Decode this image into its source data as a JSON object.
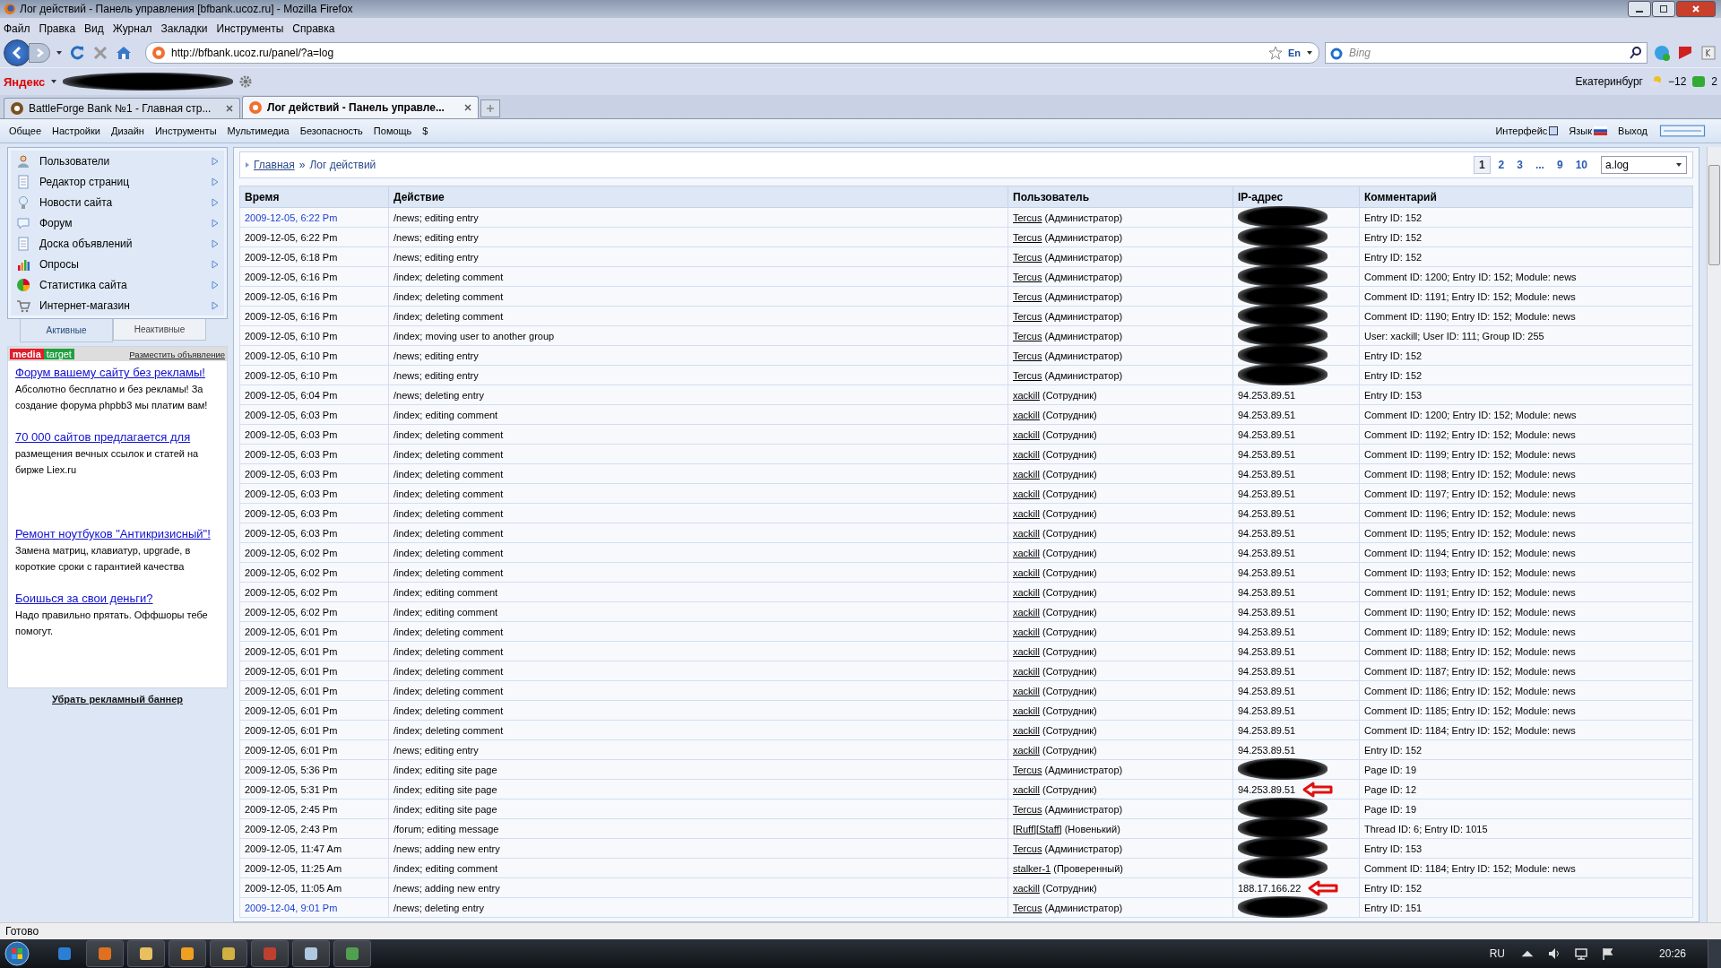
{
  "window": {
    "title": "Лог действий - Панель управления [bfbank.ucoz.ru] - Mozilla Firefox"
  },
  "menu": [
    "Файл",
    "Правка",
    "Вид",
    "Журнал",
    "Закладки",
    "Инструменты",
    "Справка"
  ],
  "address_bar": {
    "url": "http://bfbank.ucoz.ru/panel/?a=log",
    "language": "En"
  },
  "search": {
    "placeholder": "Bing"
  },
  "yandex_bar": {
    "logo": "Яндекс",
    "city": "Екатеринбург",
    "temperature": "−12",
    "count": "2"
  },
  "tabs": [
    {
      "label": "BattleForge Bank №1 - Главная стр...",
      "selected": false
    },
    {
      "label": "Лог действий - Панель управле...",
      "selected": true
    }
  ],
  "site_menu": {
    "items": [
      "Общее",
      "Настройки",
      "Дизайн",
      "Инструменты",
      "Мультимедиа",
      "Безопасность",
      "Помощь",
      "$"
    ],
    "interface": "Интерфейс",
    "language": "Язык",
    "logout": "Выход"
  },
  "sidebar": {
    "items": [
      "Пользователи",
      "Редактор страниц",
      "Новости сайта",
      "Форум",
      "Доска объявлений",
      "Опросы",
      "Статистика сайта",
      "Интернет-магазин"
    ],
    "tabs": [
      {
        "label": "Активные",
        "selected": true
      },
      {
        "label": "Неактивные",
        "selected": false
      }
    ],
    "ad_block": {
      "logo": [
        "media",
        "target"
      ],
      "place_ad": "Разместить объявление",
      "ads": [
        {
          "title": "Форум вашему сайту без рекламы!",
          "text": "Абсолютно бесплатно и без рекламы! За создание форума phpbb3 мы платим вам!"
        },
        {
          "title": "70 000 сайтов предлагается для",
          "text": "размещения вечных ссылок и статей на бирже Liex.ru"
        },
        {
          "title": "Ремонт ноутбуков \"Антикризисный\"!",
          "text": "Замена матриц, клавиатур, upgrade, в короткие сроки с гарантией качества"
        },
        {
          "title": "Боишься за свои деньги?",
          "text": "Надо правильно прятать. Оффшоры тебе помогут."
        }
      ],
      "remove": "Убрать рекламный баннер"
    }
  },
  "breadcrumb": {
    "items": [
      "Главная",
      "Лог действий"
    ],
    "separator": "»"
  },
  "pagination": {
    "pages": [
      {
        "label": "1",
        "selected": true
      },
      {
        "label": "2",
        "selected": false
      },
      {
        "label": "3",
        "selected": false
      },
      {
        "label": "...",
        "selected": false
      },
      {
        "label": "9",
        "selected": false
      },
      {
        "label": "10",
        "selected": false
      }
    ],
    "sort": "a.log"
  },
  "table": {
    "columns": [
      "Время",
      "Действие",
      "Пользователь",
      "IP-адрес",
      "Комментарий"
    ],
    "rows": [
      {
        "time": "2009-12-05, 6:22 Pm",
        "visited": true,
        "action": "/news; editing entry",
        "user": "Tercus",
        "role": "(Администратор)",
        "redacted": true,
        "arrow": false,
        "comment": "Entry ID: 152"
      },
      {
        "time": "2009-12-05, 6:22 Pm",
        "visited": false,
        "action": "/news; editing entry",
        "user": "Tercus",
        "role": "(Администратор)",
        "redacted": true,
        "arrow": false,
        "comment": "Entry ID: 152"
      },
      {
        "time": "2009-12-05, 6:18 Pm",
        "visited": false,
        "action": "/news; editing entry",
        "user": "Tercus",
        "role": "(Администратор)",
        "redacted": true,
        "arrow": false,
        "comment": "Entry ID: 152"
      },
      {
        "time": "2009-12-05, 6:16 Pm",
        "visited": false,
        "action": "/index; deleting comment",
        "user": "Tercus",
        "role": "(Администратор)",
        "redacted": true,
        "arrow": false,
        "comment": "Comment ID: 1200; Entry ID: 152; Module: news"
      },
      {
        "time": "2009-12-05, 6:16 Pm",
        "visited": false,
        "action": "/index; deleting comment",
        "user": "Tercus",
        "role": "(Администратор)",
        "redacted": true,
        "arrow": false,
        "comment": "Comment ID: 1191; Entry ID: 152; Module: news"
      },
      {
        "time": "2009-12-05, 6:16 Pm",
        "visited": false,
        "action": "/index; deleting comment",
        "user": "Tercus",
        "role": "(Администратор)",
        "redacted": true,
        "arrow": false,
        "comment": "Comment ID: 1190; Entry ID: 152; Module: news"
      },
      {
        "time": "2009-12-05, 6:10 Pm",
        "visited": false,
        "action": "/index; moving user to another group",
        "user": "Tercus",
        "role": "(Администратор)",
        "redacted": true,
        "arrow": false,
        "comment": "User: xackill; User ID: 111; Group ID: 255"
      },
      {
        "time": "2009-12-05, 6:10 Pm",
        "visited": false,
        "action": "/news; editing entry",
        "user": "Tercus",
        "role": "(Администратор)",
        "redacted": true,
        "arrow": false,
        "comment": "Entry ID: 152"
      },
      {
        "time": "2009-12-05, 6:10 Pm",
        "visited": false,
        "action": "/news; editing entry",
        "user": "Tercus",
        "role": "(Администратор)",
        "redacted": true,
        "arrow": false,
        "comment": "Entry ID: 152"
      },
      {
        "time": "2009-12-05, 6:04 Pm",
        "visited": false,
        "action": "/news; deleting entry",
        "user": "xackill",
        "role": "(Сотрудник)",
        "ip": "94.253.89.51",
        "redacted": false,
        "arrow": false,
        "comment": "Entry ID: 153"
      },
      {
        "time": "2009-12-05, 6:03 Pm",
        "visited": false,
        "action": "/index; editing comment",
        "user": "xackill",
        "role": "(Сотрудник)",
        "ip": "94.253.89.51",
        "redacted": false,
        "arrow": false,
        "comment": "Comment ID: 1200; Entry ID: 152; Module: news"
      },
      {
        "time": "2009-12-05, 6:03 Pm",
        "visited": false,
        "action": "/index; deleting comment",
        "user": "xackill",
        "role": "(Сотрудник)",
        "ip": "94.253.89.51",
        "redacted": false,
        "arrow": false,
        "comment": "Comment ID: 1192; Entry ID: 152; Module: news"
      },
      {
        "time": "2009-12-05, 6:03 Pm",
        "visited": false,
        "action": "/index; deleting comment",
        "user": "xackill",
        "role": "(Сотрудник)",
        "ip": "94.253.89.51",
        "redacted": false,
        "arrow": false,
        "comment": "Comment ID: 1199; Entry ID: 152; Module: news"
      },
      {
        "time": "2009-12-05, 6:03 Pm",
        "visited": false,
        "action": "/index; deleting comment",
        "user": "xackill",
        "role": "(Сотрудник)",
        "ip": "94.253.89.51",
        "redacted": false,
        "arrow": false,
        "comment": "Comment ID: 1198; Entry ID: 152; Module: news"
      },
      {
        "time": "2009-12-05, 6:03 Pm",
        "visited": false,
        "action": "/index; deleting comment",
        "user": "xackill",
        "role": "(Сотрудник)",
        "ip": "94.253.89.51",
        "redacted": false,
        "arrow": false,
        "comment": "Comment ID: 1197; Entry ID: 152; Module: news"
      },
      {
        "time": "2009-12-05, 6:03 Pm",
        "visited": false,
        "action": "/index; deleting comment",
        "user": "xackill",
        "role": "(Сотрудник)",
        "ip": "94.253.89.51",
        "redacted": false,
        "arrow": false,
        "comment": "Comment ID: 1196; Entry ID: 152; Module: news"
      },
      {
        "time": "2009-12-05, 6:03 Pm",
        "visited": false,
        "action": "/index; deleting comment",
        "user": "xackill",
        "role": "(Сотрудник)",
        "ip": "94.253.89.51",
        "redacted": false,
        "arrow": false,
        "comment": "Comment ID: 1195; Entry ID: 152; Module: news"
      },
      {
        "time": "2009-12-05, 6:02 Pm",
        "visited": false,
        "action": "/index; deleting comment",
        "user": "xackill",
        "role": "(Сотрудник)",
        "ip": "94.253.89.51",
        "redacted": false,
        "arrow": false,
        "comment": "Comment ID: 1194; Entry ID: 152; Module: news"
      },
      {
        "time": "2009-12-05, 6:02 Pm",
        "visited": false,
        "action": "/index; deleting comment",
        "user": "xackill",
        "role": "(Сотрудник)",
        "ip": "94.253.89.51",
        "redacted": false,
        "arrow": false,
        "comment": "Comment ID: 1193; Entry ID: 152; Module: news"
      },
      {
        "time": "2009-12-05, 6:02 Pm",
        "visited": false,
        "action": "/index; editing comment",
        "user": "xackill",
        "role": "(Сотрудник)",
        "ip": "94.253.89.51",
        "redacted": false,
        "arrow": false,
        "comment": "Comment ID: 1191; Entry ID: 152; Module: news"
      },
      {
        "time": "2009-12-05, 6:02 Pm",
        "visited": false,
        "action": "/index; editing comment",
        "user": "xackill",
        "role": "(Сотрудник)",
        "ip": "94.253.89.51",
        "redacted": false,
        "arrow": false,
        "comment": "Comment ID: 1190; Entry ID: 152; Module: news"
      },
      {
        "time": "2009-12-05, 6:01 Pm",
        "visited": false,
        "action": "/index; deleting comment",
        "user": "xackill",
        "role": "(Сотрудник)",
        "ip": "94.253.89.51",
        "redacted": false,
        "arrow": false,
        "comment": "Comment ID: 1189; Entry ID: 152; Module: news"
      },
      {
        "time": "2009-12-05, 6:01 Pm",
        "visited": false,
        "action": "/index; deleting comment",
        "user": "xackill",
        "role": "(Сотрудник)",
        "ip": "94.253.89.51",
        "redacted": false,
        "arrow": false,
        "comment": "Comment ID: 1188; Entry ID: 152; Module: news"
      },
      {
        "time": "2009-12-05, 6:01 Pm",
        "visited": false,
        "action": "/index; deleting comment",
        "user": "xackill",
        "role": "(Сотрудник)",
        "ip": "94.253.89.51",
        "redacted": false,
        "arrow": false,
        "comment": "Comment ID: 1187; Entry ID: 152; Module: news"
      },
      {
        "time": "2009-12-05, 6:01 Pm",
        "visited": false,
        "action": "/index; deleting comment",
        "user": "xackill",
        "role": "(Сотрудник)",
        "ip": "94.253.89.51",
        "redacted": false,
        "arrow": false,
        "comment": "Comment ID: 1186; Entry ID: 152; Module: news"
      },
      {
        "time": "2009-12-05, 6:01 Pm",
        "visited": false,
        "action": "/index; deleting comment",
        "user": "xackill",
        "role": "(Сотрудник)",
        "ip": "94.253.89.51",
        "redacted": false,
        "arrow": false,
        "comment": "Comment ID: 1185; Entry ID: 152; Module: news"
      },
      {
        "time": "2009-12-05, 6:01 Pm",
        "visited": false,
        "action": "/index; deleting comment",
        "user": "xackill",
        "role": "(Сотрудник)",
        "ip": "94.253.89.51",
        "redacted": false,
        "arrow": false,
        "comment": "Comment ID: 1184; Entry ID: 152; Module: news"
      },
      {
        "time": "2009-12-05, 6:01 Pm",
        "visited": false,
        "action": "/news; editing entry",
        "user": "xackill",
        "role": "(Сотрудник)",
        "ip": "94.253.89.51",
        "redacted": false,
        "arrow": false,
        "comment": "Entry ID: 152"
      },
      {
        "time": "2009-12-05, 5:36 Pm",
        "visited": false,
        "action": "/index; editing site page",
        "user": "Tercus",
        "role": "(Администратор)",
        "redacted": true,
        "arrow": false,
        "comment": "Page ID: 19"
      },
      {
        "time": "2009-12-05, 5:31 Pm",
        "visited": false,
        "action": "/index; editing site page",
        "user": "xackill",
        "role": "(Сотрудник)",
        "ip": "94.253.89.51",
        "redacted": false,
        "arrow": true,
        "comment": "Page ID: 12"
      },
      {
        "time": "2009-12-05, 2:45 Pm",
        "visited": false,
        "action": "/index; editing site page",
        "user": "Tercus",
        "role": "(Администратор)",
        "redacted": true,
        "arrow": false,
        "comment": "Page ID: 19"
      },
      {
        "time": "2009-12-05, 2:43 Pm",
        "visited": false,
        "action": "/forum; editing message",
        "user": "[Ruff][Staff]",
        "role": "(Новенький)",
        "redacted": true,
        "arrow": false,
        "comment": "Thread ID: 6; Entry ID: 1015"
      },
      {
        "time": "2009-12-05, 11:47 Am",
        "visited": false,
        "action": "/news; adding new entry",
        "user": "Tercus",
        "role": "(Администратор)",
        "redacted": true,
        "arrow": false,
        "comment": "Entry ID: 153"
      },
      {
        "time": "2009-12-05, 11:25 Am",
        "visited": false,
        "action": "/index; editing comment",
        "user": "stalker-1",
        "role": "(Проверенный)",
        "redacted": true,
        "arrow": false,
        "comment": "Comment ID: 1184; Entry ID: 152; Module: news"
      },
      {
        "time": "2009-12-05, 11:05 Am",
        "visited": false,
        "action": "/news; adding new entry",
        "user": "xackill",
        "role": "(Сотрудник)",
        "ip": "188.17.166.22",
        "redacted": false,
        "arrow": true,
        "comment": "Entry ID: 152"
      },
      {
        "time": "2009-12-04, 9:01 Pm",
        "visited": true,
        "action": "/news; deleting entry",
        "user": "Tercus",
        "role": "(Администратор)",
        "redacted": true,
        "arrow": false,
        "comment": "Entry ID: 151"
      }
    ]
  },
  "status_bar": {
    "text": "Готово"
  },
  "taskbar": {
    "language": "RU",
    "clock": "20:26"
  }
}
